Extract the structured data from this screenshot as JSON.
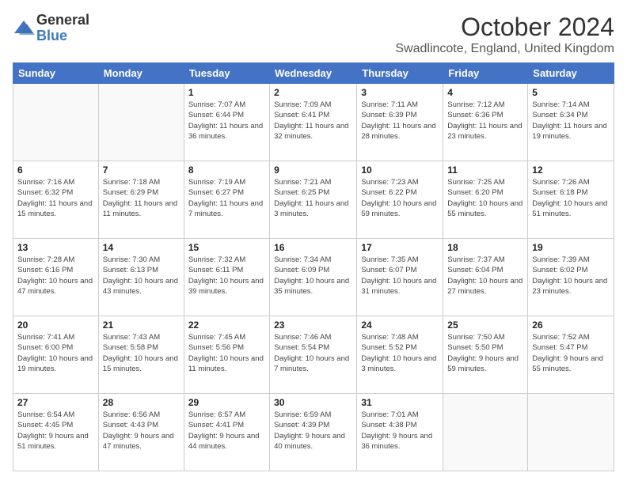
{
  "logo": {
    "general": "General",
    "blue": "Blue"
  },
  "title": "October 2024",
  "location": "Swadlincote, England, United Kingdom",
  "headers": [
    "Sunday",
    "Monday",
    "Tuesday",
    "Wednesday",
    "Thursday",
    "Friday",
    "Saturday"
  ],
  "weeks": [
    [
      {
        "day": "",
        "info": ""
      },
      {
        "day": "",
        "info": ""
      },
      {
        "day": "1",
        "info": "Sunrise: 7:07 AM\nSunset: 6:44 PM\nDaylight: 11 hours and 36 minutes."
      },
      {
        "day": "2",
        "info": "Sunrise: 7:09 AM\nSunset: 6:41 PM\nDaylight: 11 hours and 32 minutes."
      },
      {
        "day": "3",
        "info": "Sunrise: 7:11 AM\nSunset: 6:39 PM\nDaylight: 11 hours and 28 minutes."
      },
      {
        "day": "4",
        "info": "Sunrise: 7:12 AM\nSunset: 6:36 PM\nDaylight: 11 hours and 23 minutes."
      },
      {
        "day": "5",
        "info": "Sunrise: 7:14 AM\nSunset: 6:34 PM\nDaylight: 11 hours and 19 minutes."
      }
    ],
    [
      {
        "day": "6",
        "info": "Sunrise: 7:16 AM\nSunset: 6:32 PM\nDaylight: 11 hours and 15 minutes."
      },
      {
        "day": "7",
        "info": "Sunrise: 7:18 AM\nSunset: 6:29 PM\nDaylight: 11 hours and 11 minutes."
      },
      {
        "day": "8",
        "info": "Sunrise: 7:19 AM\nSunset: 6:27 PM\nDaylight: 11 hours and 7 minutes."
      },
      {
        "day": "9",
        "info": "Sunrise: 7:21 AM\nSunset: 6:25 PM\nDaylight: 11 hours and 3 minutes."
      },
      {
        "day": "10",
        "info": "Sunrise: 7:23 AM\nSunset: 6:22 PM\nDaylight: 10 hours and 59 minutes."
      },
      {
        "day": "11",
        "info": "Sunrise: 7:25 AM\nSunset: 6:20 PM\nDaylight: 10 hours and 55 minutes."
      },
      {
        "day": "12",
        "info": "Sunrise: 7:26 AM\nSunset: 6:18 PM\nDaylight: 10 hours and 51 minutes."
      }
    ],
    [
      {
        "day": "13",
        "info": "Sunrise: 7:28 AM\nSunset: 6:16 PM\nDaylight: 10 hours and 47 minutes."
      },
      {
        "day": "14",
        "info": "Sunrise: 7:30 AM\nSunset: 6:13 PM\nDaylight: 10 hours and 43 minutes."
      },
      {
        "day": "15",
        "info": "Sunrise: 7:32 AM\nSunset: 6:11 PM\nDaylight: 10 hours and 39 minutes."
      },
      {
        "day": "16",
        "info": "Sunrise: 7:34 AM\nSunset: 6:09 PM\nDaylight: 10 hours and 35 minutes."
      },
      {
        "day": "17",
        "info": "Sunrise: 7:35 AM\nSunset: 6:07 PM\nDaylight: 10 hours and 31 minutes."
      },
      {
        "day": "18",
        "info": "Sunrise: 7:37 AM\nSunset: 6:04 PM\nDaylight: 10 hours and 27 minutes."
      },
      {
        "day": "19",
        "info": "Sunrise: 7:39 AM\nSunset: 6:02 PM\nDaylight: 10 hours and 23 minutes."
      }
    ],
    [
      {
        "day": "20",
        "info": "Sunrise: 7:41 AM\nSunset: 6:00 PM\nDaylight: 10 hours and 19 minutes."
      },
      {
        "day": "21",
        "info": "Sunrise: 7:43 AM\nSunset: 5:58 PM\nDaylight: 10 hours and 15 minutes."
      },
      {
        "day": "22",
        "info": "Sunrise: 7:45 AM\nSunset: 5:56 PM\nDaylight: 10 hours and 11 minutes."
      },
      {
        "day": "23",
        "info": "Sunrise: 7:46 AM\nSunset: 5:54 PM\nDaylight: 10 hours and 7 minutes."
      },
      {
        "day": "24",
        "info": "Sunrise: 7:48 AM\nSunset: 5:52 PM\nDaylight: 10 hours and 3 minutes."
      },
      {
        "day": "25",
        "info": "Sunrise: 7:50 AM\nSunset: 5:50 PM\nDaylight: 9 hours and 59 minutes."
      },
      {
        "day": "26",
        "info": "Sunrise: 7:52 AM\nSunset: 5:47 PM\nDaylight: 9 hours and 55 minutes."
      }
    ],
    [
      {
        "day": "27",
        "info": "Sunrise: 6:54 AM\nSunset: 4:45 PM\nDaylight: 9 hours and 51 minutes."
      },
      {
        "day": "28",
        "info": "Sunrise: 6:56 AM\nSunset: 4:43 PM\nDaylight: 9 hours and 47 minutes."
      },
      {
        "day": "29",
        "info": "Sunrise: 6:57 AM\nSunset: 4:41 PM\nDaylight: 9 hours and 44 minutes."
      },
      {
        "day": "30",
        "info": "Sunrise: 6:59 AM\nSunset: 4:39 PM\nDaylight: 9 hours and 40 minutes."
      },
      {
        "day": "31",
        "info": "Sunrise: 7:01 AM\nSunset: 4:38 PM\nDaylight: 9 hours and 36 minutes."
      },
      {
        "day": "",
        "info": ""
      },
      {
        "day": "",
        "info": ""
      }
    ]
  ]
}
